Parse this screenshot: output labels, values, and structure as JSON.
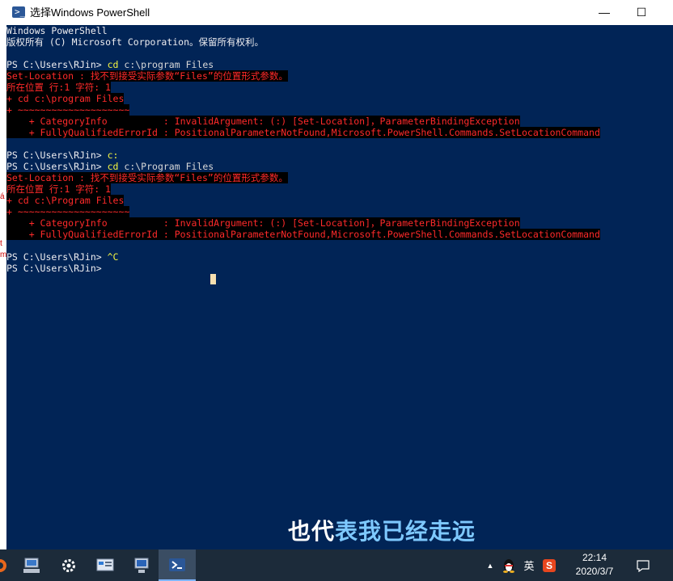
{
  "window": {
    "title": "选择Windows PowerShell",
    "minimize_icon": "minimize-icon",
    "maximize_icon": "maximize-icon",
    "min_glyph": "—",
    "max_glyph": "☐"
  },
  "console": {
    "header": [
      "Windows PowerShell",
      "版权所有 (C) Microsoft Corporation。保留所有权利。"
    ],
    "block1": {
      "prompt": "PS C:\\Users\\RJin> ",
      "cmd": "cd",
      "arg": " c:\\program Files",
      "err1": "Set-Location : 找不到接受实际参数“Files”的位置形式参数。",
      "err2": "所在位置 行:1 字符: 1",
      "err3": "+ cd c:\\program Files",
      "err4": "+ ~~~~~~~~~~~~~~~~~~~~",
      "err5": "    + CategoryInfo          : InvalidArgument: (:) [Set-Location]，ParameterBindingException",
      "err6": "    + FullyQualifiedErrorId : PositionalParameterNotFound,Microsoft.PowerShell.Commands.SetLocationCommand"
    },
    "line_c": {
      "prompt": "PS C:\\Users\\RJin> ",
      "cmd": "c:"
    },
    "block2": {
      "prompt": "PS C:\\Users\\RJin> ",
      "cmd": "cd",
      "arg": " c:\\Program Files",
      "err1": "Set-Location : 找不到接受实际参数“Files”的位置形式参数。",
      "err2": "所在位置 行:1 字符: 1",
      "err3": "+ cd c:\\Program Files",
      "err4": "+ ~~~~~~~~~~~~~~~~~~~~",
      "err5": "    + CategoryInfo          : InvalidArgument: (:) [Set-Location]，ParameterBindingException",
      "err6": "    + FullyQualifiedErrorId : PositionalParameterNotFound,Microsoft.PowerShell.Commands.SetLocationCommand"
    },
    "line_ctrlc": {
      "prompt": "PS C:\\Users\\RJin> ",
      "cmd": "^C"
    },
    "line_last": {
      "prompt": "PS C:\\Users\\RJin>"
    }
  },
  "subtitle": {
    "white": "也代",
    "blue": "表我已经走远"
  },
  "taskbar": {
    "buttons": [
      "app-icon",
      "network-computer-icon",
      "settings-gear-icon",
      "control-panel-icon",
      "remote-desktop-icon",
      "powershell-icon"
    ],
    "tray_chevron": "▲",
    "ime_label": "英",
    "sogou_label": "S",
    "time": "22:14",
    "date": "2020/3/7"
  },
  "colors": {
    "console_bg": "#012456",
    "error_red": "#ff2a2a",
    "command_yellow": "#f5f540",
    "subtitle_blue": "#7ec9ff"
  }
}
